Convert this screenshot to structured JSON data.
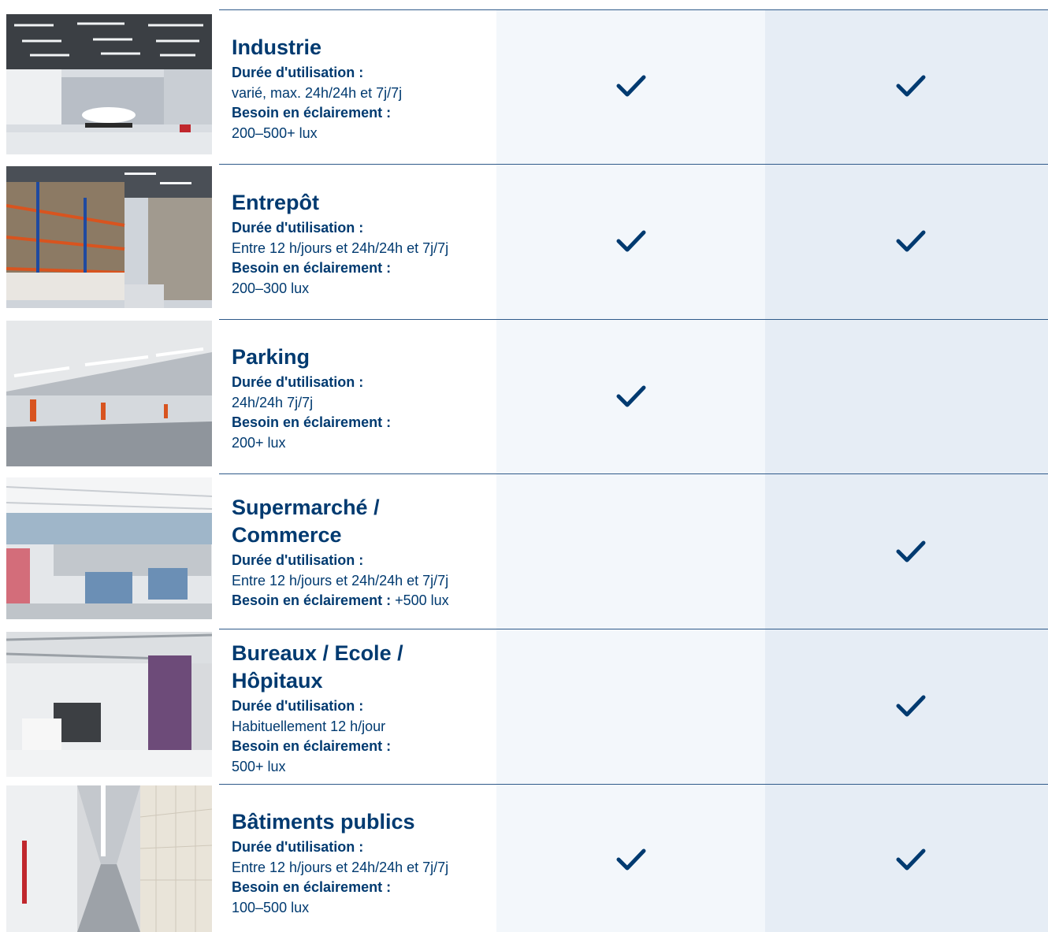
{
  "colors": {
    "text": "#003a70",
    "col_a_bg": "#f3f7fb",
    "col_b_bg": "#e6edf5",
    "rule": "#2f5a8a"
  },
  "rows": [
    {
      "title_lines": [
        "Industrie"
      ],
      "usage_label": "Durée d'utilisation :",
      "usage_value": "varié, max. 24h/24h et 7j/7j",
      "light_label": "Besoin en éclairement :",
      "light_value": "200–500+ lux",
      "col_a_check": true,
      "col_b_check": true,
      "photo_icon": "industrial-hall-photo"
    },
    {
      "title_lines": [
        "Entrepôt"
      ],
      "usage_label": "Durée d'utilisation :",
      "usage_value": "Entre 12 h/jours et 24h/24h et 7j/7j",
      "light_label": "Besoin en éclairement :",
      "light_value": "200–300 lux",
      "col_a_check": true,
      "col_b_check": true,
      "photo_icon": "warehouse-photo"
    },
    {
      "title_lines": [
        "Parking"
      ],
      "usage_label": "Durée d'utilisation :",
      "usage_value": "24h/24h 7j/7j",
      "light_label": "Besoin en éclairement :",
      "light_value": "200+ lux",
      "col_a_check": true,
      "col_b_check": false,
      "photo_icon": "parking-garage-photo"
    },
    {
      "title_lines": [
        "Supermarché /",
        "Commerce"
      ],
      "usage_label": "Durée d'utilisation :",
      "usage_value": "Entre 12 h/jours et 24h/24h et 7j/7j",
      "light_label": "Besoin en éclairement :",
      "light_value": "+500 lux",
      "col_a_check": false,
      "col_b_check": true,
      "photo_icon": "supermarket-photo"
    },
    {
      "title_lines": [
        "Bureaux / Ecole /",
        "Hôpitaux"
      ],
      "usage_label": "Durée d'utilisation :",
      "usage_value": "Habituellement 12 h/jour",
      "light_label": "Besoin en éclairement :",
      "light_value": "500+ lux",
      "col_a_check": false,
      "col_b_check": true,
      "photo_icon": "office-lobby-photo"
    },
    {
      "title_lines": [
        "Bâtiments publics"
      ],
      "usage_label": "Durée d'utilisation :",
      "usage_value": "Entre 12 h/jours et 24h/24h et 7j/7j",
      "light_label": "Besoin en éclairement :",
      "light_value": "100–500 lux",
      "col_a_check": true,
      "col_b_check": true,
      "photo_icon": "public-corridor-photo"
    }
  ]
}
